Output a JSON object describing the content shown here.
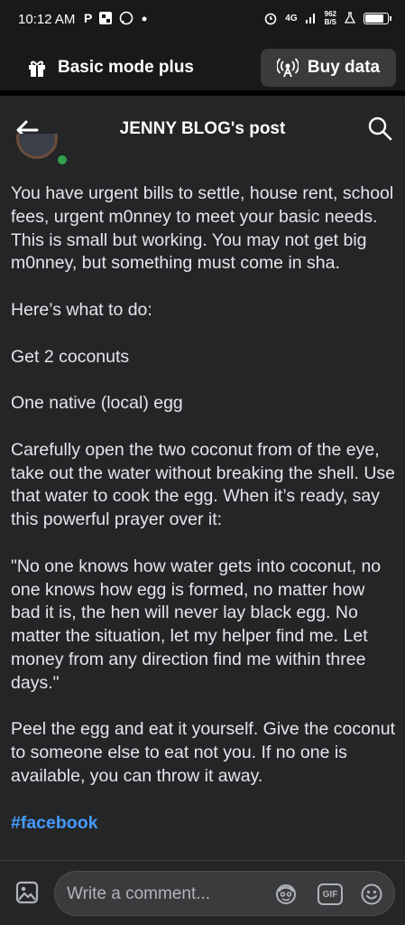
{
  "status_bar": {
    "time": "10:12 AM",
    "network": "4G",
    "speed_value": "962",
    "speed_unit": "B/S",
    "battery_level": 0.9
  },
  "mode_bar": {
    "label": "Basic mode plus",
    "buy_data_label": "Buy data"
  },
  "header": {
    "title": "JENNY BLOG's post"
  },
  "post": {
    "paragraphs": [
      "You have urgent bills to settle, house rent, school fees, urgent m0nney to meet your basic needs. This is small but working. You may not get big m0nney, but something must come in sha.",
      "Here’s what to do:",
      "Get 2 coconuts",
      "One native (local) egg",
      "Carefully open the two coconut  from of the eye, take out the water without breaking the shell. Use that water to cook the egg. When it’s ready, say this powerful prayer over it:",
      "\"No one knows how water gets into coconut, no one knows how egg is formed, no matter how bad it is, the hen will never lay black egg. No matter the situation, let my helper find me. Let money from any direction find me within three days.\"",
      "Peel the egg and eat it yourself. Give the coconut to someone else to eat not you. If no one is available, you can throw it away."
    ],
    "hashtag": "#facebook"
  },
  "comment_bar": {
    "placeholder": "Write a comment...",
    "gif_label": "GIF"
  },
  "icons": {
    "gift": "gift-icon",
    "data": "signal-icon",
    "back": "back-arrow-icon",
    "search": "search-icon",
    "photo": "photo-icon",
    "avatar": "avatar-sticker-icon",
    "gif": "gif-icon",
    "emoji": "emoji-icon"
  },
  "colors": {
    "background": "#242526",
    "top_bar": "#18191a",
    "hashtag": "#4599ff",
    "online": "#31a24c"
  }
}
